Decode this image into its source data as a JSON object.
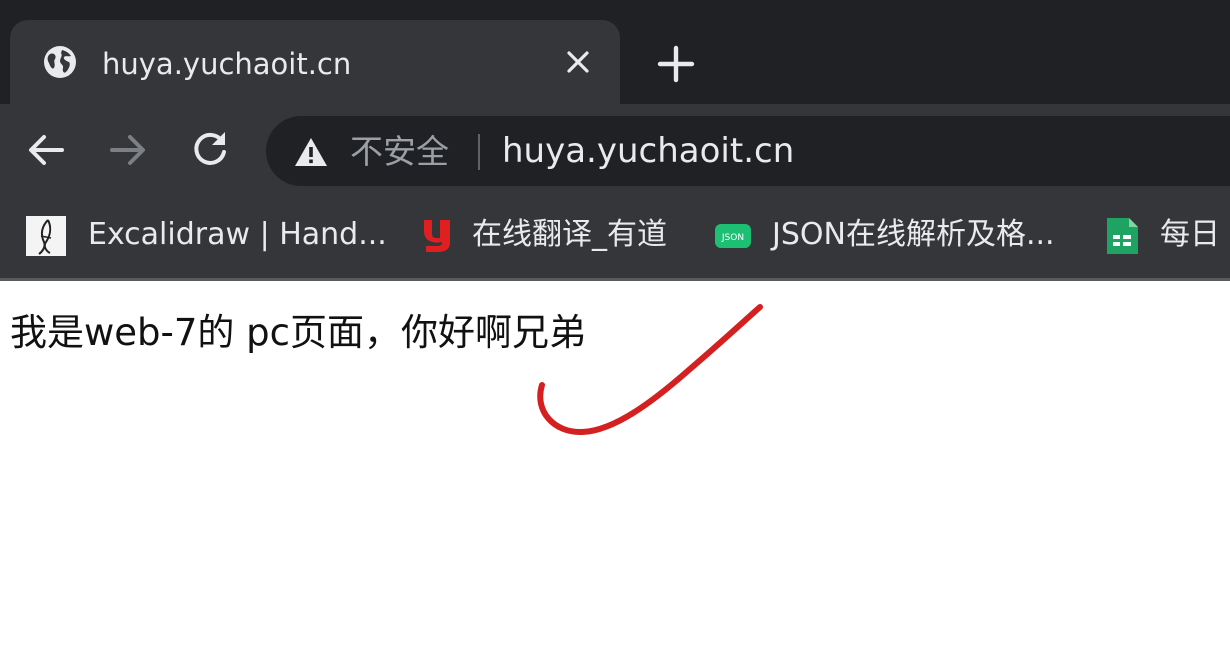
{
  "tab": {
    "title": "huya.yuchaoit.cn",
    "favicon": "globe-icon",
    "close_icon": "close-icon"
  },
  "new_tab_icon": "plus-icon",
  "toolbar": {
    "back_icon": "arrow-left-icon",
    "forward_icon": "arrow-right-icon",
    "reload_icon": "reload-icon"
  },
  "omnibox": {
    "security_icon": "warning-triangle-icon",
    "security_text": "不安全",
    "url": "huya.yuchaoit.cn"
  },
  "bookmarks": [
    {
      "label": "Excalidraw | Hand...",
      "icon": "excalidraw-icon"
    },
    {
      "label": "在线翻译_有道",
      "icon": "youdao-icon",
      "icon_color": "#e02020"
    },
    {
      "label": "JSON在线解析及格...",
      "icon": "json-icon",
      "icon_text": "JSON",
      "icon_color": "#1dbf73"
    },
    {
      "label": "每日",
      "icon": "sheets-icon",
      "icon_color": "#1ea362"
    }
  ],
  "page": {
    "text": "我是web-7的 pc页面，你好啊兄弟",
    "annotation_color": "#d42020"
  },
  "colors": {
    "tabstrip": "#202124",
    "toolbar": "#35363a",
    "omnibox": "#202124",
    "text_light": "#e8eaed",
    "text_muted": "#9aa0a6"
  }
}
